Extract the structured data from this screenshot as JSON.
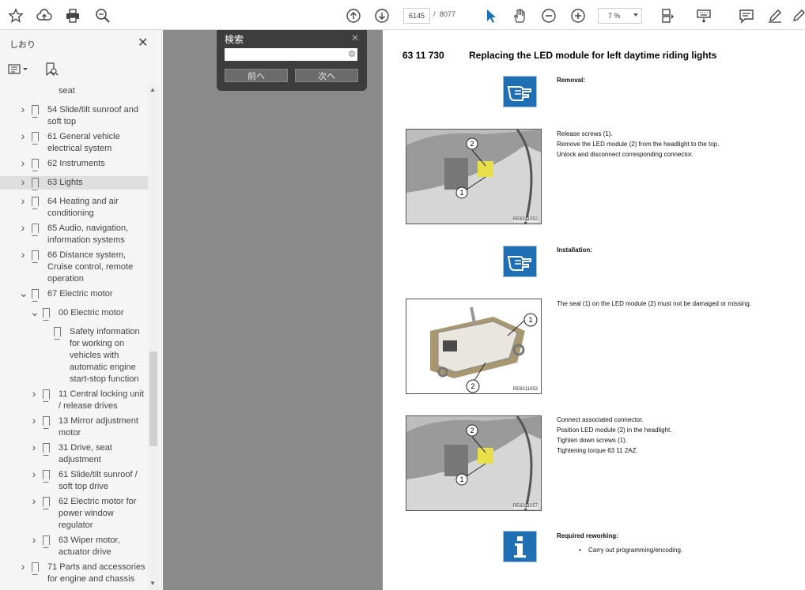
{
  "toolbar": {
    "icons": [
      "star-icon",
      "upload-icon",
      "print-icon",
      "zoom-search-icon",
      "page-up-icon",
      "page-down-icon",
      "select-cursor-icon",
      "hand-icon",
      "zoom-out-icon",
      "zoom-in-icon",
      "page-layout-icon",
      "keyboard-icon",
      "comment-icon",
      "highlight-pen-icon",
      "sign-icon"
    ],
    "page_current": "6145",
    "page_separator": "/",
    "page_total": "8077",
    "zoom": "7 %",
    "accent": "#1f6fb4"
  },
  "sidebar": {
    "title": "しおり",
    "close": "✕",
    "items": [
      {
        "label": "seat",
        "depth": 1,
        "caret": "",
        "bookmark": false
      },
      {
        "label": "54 Slide/tilt sunroof and soft top",
        "depth": 0,
        "caret": ">",
        "bookmark": true
      },
      {
        "label": "61 General vehicle electrical system",
        "depth": 0,
        "caret": ">",
        "bookmark": true
      },
      {
        "label": "62 Instruments",
        "depth": 0,
        "caret": ">",
        "bookmark": true
      },
      {
        "label": "63 Lights",
        "depth": 0,
        "caret": ">",
        "bookmark": true,
        "selected": true
      },
      {
        "label": "64 Heating and air conditioning",
        "depth": 0,
        "caret": ">",
        "bookmark": true
      },
      {
        "label": "65 Audio, navigation, information systems",
        "depth": 0,
        "caret": ">",
        "bookmark": true
      },
      {
        "label": "66 Distance system, Cruise control, remote operation",
        "depth": 0,
        "caret": ">",
        "bookmark": true
      },
      {
        "label": "67 Electric motor",
        "depth": 0,
        "caret": "v",
        "bookmark": true
      },
      {
        "label": "00 Electric motor",
        "depth": 1,
        "caret": "v",
        "bookmark": true
      },
      {
        "label": "Safety information for working on vehicles with automatic engine start-stop function",
        "depth": 2,
        "caret": "",
        "bookmark": true
      },
      {
        "label": "11 Central locking unit / release drives",
        "depth": 1,
        "caret": ">",
        "bookmark": true
      },
      {
        "label": "13 Mirror adjustment motor",
        "depth": 1,
        "caret": ">",
        "bookmark": true
      },
      {
        "label": "31 Drive, seat adjustment",
        "depth": 1,
        "caret": ">",
        "bookmark": true
      },
      {
        "label": "61 Slide/tilt sunroof / soft top drive",
        "depth": 1,
        "caret": ">",
        "bookmark": true
      },
      {
        "label": "62 Electric motor for power window regulator",
        "depth": 1,
        "caret": ">",
        "bookmark": true
      },
      {
        "label": "63 Wiper motor, actuator drive",
        "depth": 1,
        "caret": ">",
        "bookmark": true
      },
      {
        "label": "71 Parts and accessories for engine and chassis",
        "depth": 0,
        "caret": ">",
        "bookmark": true
      }
    ]
  },
  "search_panel": {
    "title": "検索",
    "close": "✕",
    "value": "",
    "prev": "前へ",
    "next": "次へ"
  },
  "document": {
    "code": "63 11 730",
    "heading": "Replacing the LED module for left daytime riding lights",
    "removal_label": "Removal:",
    "step1": [
      "Release screws (1).",
      "Remove the LED module (2) from the headlight to the top.",
      "Unlock and disconnect corresponding connector."
    ],
    "img1_caption": "RE6311052",
    "installation_label": "Installation:",
    "step2": [
      "The seal (1) on the LED module (2) must not be damaged or missing."
    ],
    "img2_caption": "RE6311053",
    "step3": [
      "Connect associated connector.",
      "Position LED module (2) in the headlight.",
      "Tighten down screws (1).",
      "Tightening torque 63 11 2AZ."
    ],
    "img3_caption": "RE6311057",
    "rework_label": "Required reworking:",
    "rework_item": "Carry out programming/encoding.",
    "callout_1": "1",
    "callout_2": "2"
  }
}
